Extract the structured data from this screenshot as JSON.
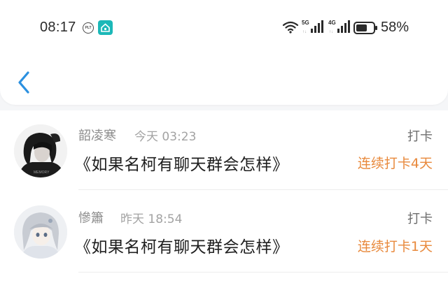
{
  "status_bar": {
    "time": "08:17",
    "notification_icons": [
      "plt-icon",
      "home-app-icon"
    ],
    "network_labels": [
      "5G",
      "4G"
    ],
    "battery_percent": "58%"
  },
  "header": {
    "back_icon": "chevron-left-icon"
  },
  "colors": {
    "accent_blue": "#2b90e0",
    "streak_orange": "#e8893c",
    "app_icon_teal": "#1cb8b8"
  },
  "items": [
    {
      "username": "韶凌寒",
      "time": "今天 03:23",
      "title": "《如果名柯有聊天群会怎样》",
      "action": "打卡",
      "streak": "连续打卡4天"
    },
    {
      "username": "慘簫",
      "time": "昨天 18:54",
      "title": "《如果名柯有聊天群会怎样》",
      "action": "打卡",
      "streak": "连续打卡1天"
    }
  ]
}
